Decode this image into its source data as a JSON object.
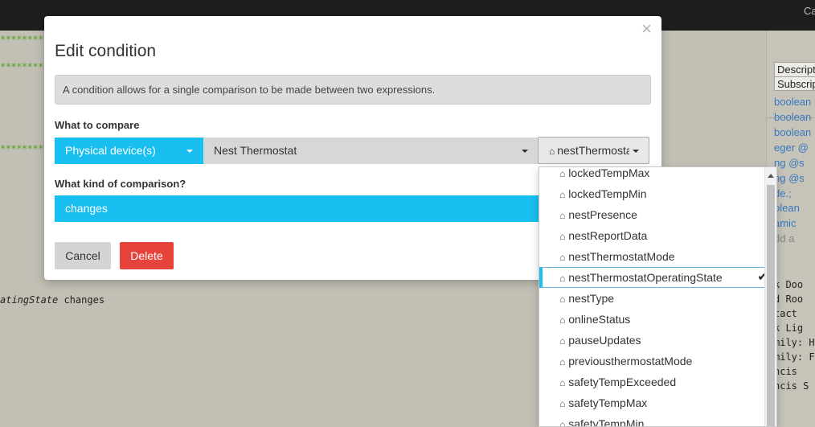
{
  "topbar": {
    "right_text": "Ca"
  },
  "background": {
    "stars": "**************",
    "code_line": {
      "italic": "atingState",
      "rest": " changes"
    },
    "right_panel": {
      "header_rows": [
        "Description",
        "Subscriptions"
      ],
      "lines": [
        {
          "text": "boolean",
          "style": "blue"
        },
        {
          "text": "boolean",
          "style": "blue"
        },
        {
          "text": "boolean",
          "style": "blue"
        },
        {
          "text": "eger @",
          "style": "blue"
        },
        {
          "text": "ng @s",
          "style": "blue"
        },
        {
          "text": "ng @s",
          "style": "blue"
        },
        {
          "text": "de.;",
          "style": "blue"
        },
        {
          "text": "olean",
          "style": "blue"
        },
        {
          "text": "amic",
          "style": "blue"
        },
        {
          "text": "dd a",
          "style": "dim"
        },
        {
          "text": "k Doo",
          "style": "dark"
        },
        {
          "text": "d Roo",
          "style": "dark"
        },
        {
          "text": "tact ",
          "style": "dark"
        },
        {
          "text": "k Lig",
          "style": "dark"
        },
        {
          "text": "mily: H",
          "style": "dark"
        },
        {
          "text": "mily: F",
          "style": "dark"
        },
        {
          "text": "ncis",
          "style": "dark"
        },
        {
          "text": "ncis S",
          "style": "dark"
        }
      ]
    }
  },
  "modal": {
    "title": "Edit condition",
    "close_glyph": "×",
    "info_text": "A condition allows for a single comparison to be made between two expressions.",
    "what_to_compare_label": "What to compare",
    "subject_type": "Physical device(s)",
    "device": "Nest Thermostat",
    "attribute_home_glyph": "⌂",
    "attribute": "nestThermostatOperatingState",
    "comparison_label": "What kind of comparison?",
    "comparison": "changes",
    "cancel_label": "Cancel",
    "delete_label": "Delete"
  },
  "attribute_dropdown": {
    "home_glyph": "⌂",
    "check_glyph": "✔",
    "items": [
      "lockedTempMax",
      "lockedTempMin",
      "nestPresence",
      "nestReportData",
      "nestThermostatMode",
      "nestThermostatOperatingState",
      "nestType",
      "onlineStatus",
      "pauseUpdates",
      "previousthermostatMode",
      "safetyTempExceeded",
      "safetyTempMax",
      "safetyTempMin"
    ],
    "selected_index": 5
  },
  "colors": {
    "accent_blue": "#18bff0",
    "delete_red": "#e5433c",
    "stars_green": "#55a11f",
    "panel_link_blue": "#3579c0"
  }
}
